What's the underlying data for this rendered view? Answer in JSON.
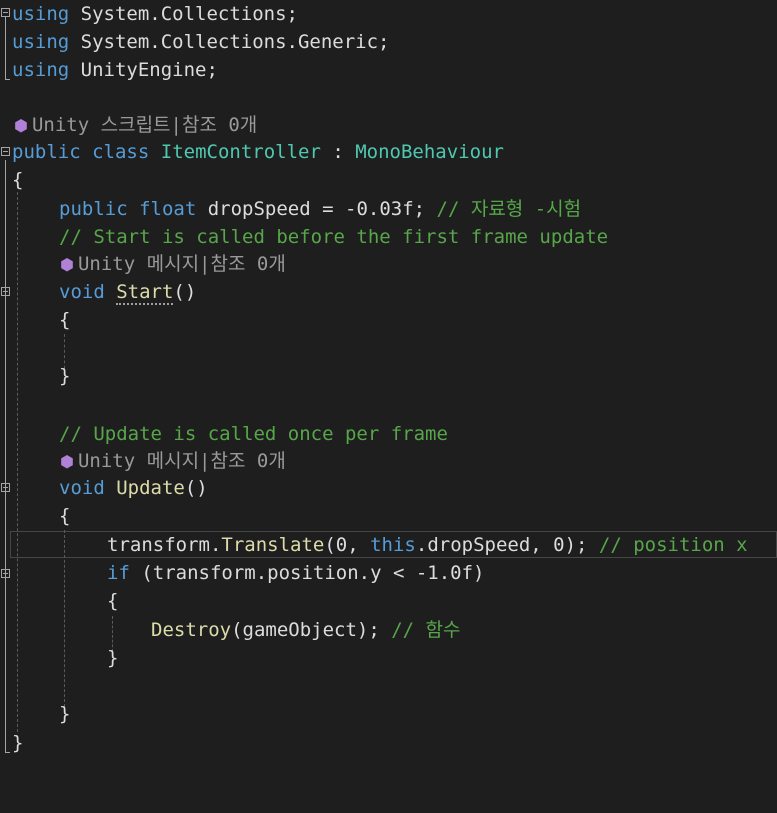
{
  "colors": {
    "background": "#1e1e1e",
    "keyword": "#569cd6",
    "type": "#4ec9b0",
    "method": "#dcdcaa",
    "comment": "#57a64a",
    "plain": "#dcdcdc",
    "codelens": "#999999",
    "codelens_icon": "#b180d7"
  },
  "codelens": {
    "class_hint": "Unity 스크립트|참조 0개",
    "start_hint": "Unity 메시지|참조 0개",
    "update_hint": "Unity 메시지|참조 0개"
  },
  "code": {
    "kw_using": "using",
    "ns_collections": " System.Collections;",
    "ns_generic": " System.Collections.Generic;",
    "ns_unity": " UnityEngine;",
    "kw_public": "public",
    "kw_class": "class",
    "class_name": "ItemController",
    "colon": " : ",
    "base_class": "MonoBehaviour",
    "open_brace": "{",
    "close_brace": "}",
    "kw_float": "float",
    "field_decl": " dropSpeed = -0.03f; ",
    "field_comment": "// 자료형 -시험",
    "start_comment": "// Start is called before the first frame update",
    "kw_void": "void",
    "start_name": "Start",
    "parens": "()",
    "update_comment": "// Update is called once per frame",
    "update_name": "Update",
    "translate_obj": "transform.",
    "translate_method": "Translate",
    "translate_args_a": "(0, ",
    "kw_this": "this",
    "translate_args_b": ".dropSpeed, 0); ",
    "translate_comment": "// position x",
    "kw_if": "if",
    "if_cond": " (transform.position.y < -1.0f)",
    "destroy_method": "Destroy",
    "destroy_args": "(gameObject); ",
    "destroy_comment": "// 함수"
  }
}
